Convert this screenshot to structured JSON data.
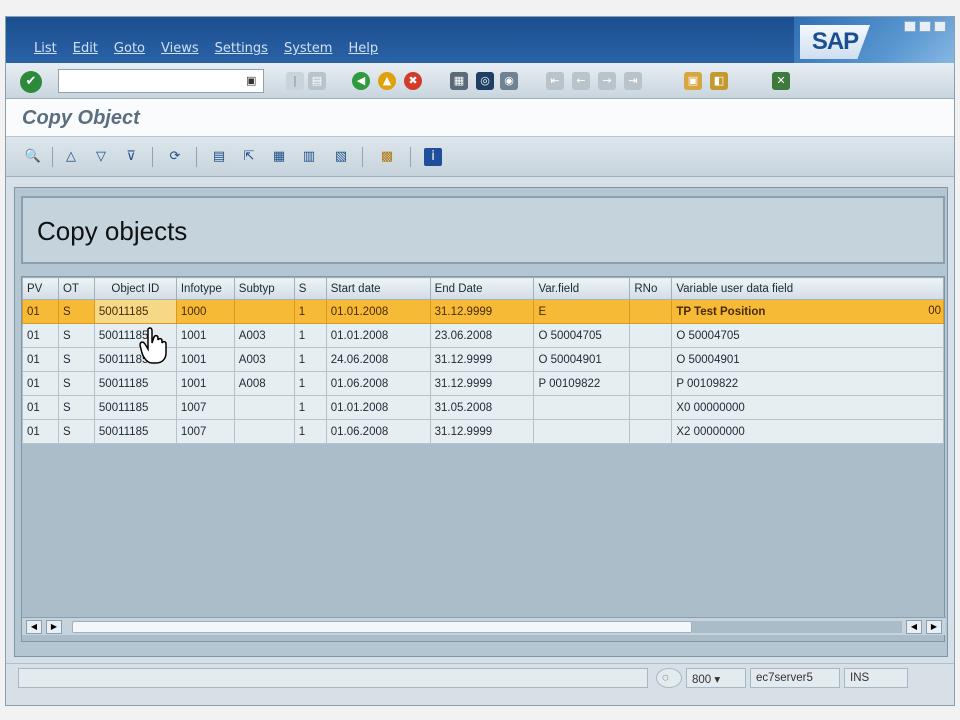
{
  "menu": [
    "List",
    "Edit",
    "Goto",
    "Views",
    "Settings",
    "System",
    "Help"
  ],
  "brand": "SAP",
  "okcode": {
    "value": ""
  },
  "title": "Copy Object",
  "group_title": "Copy objects",
  "table": {
    "columns": [
      "PV",
      "OT",
      "Object ID",
      "Infotype",
      "Subtyp",
      "S",
      "Start date",
      "End Date",
      "Var.field",
      "RNo",
      "Variable user data field"
    ],
    "rows": [
      [
        "01",
        "S",
        "50011185",
        "1000",
        "",
        "1",
        "01.01.2008",
        "31.12.9999",
        "E",
        "",
        "TP       Test Position"
      ],
      [
        "01",
        "S",
        "50011185",
        "1001",
        "A003",
        "1",
        "01.01.2008",
        "23.06.2008",
        "O 50004705",
        "",
        "O 50004705"
      ],
      [
        "01",
        "S",
        "50011185",
        "1001",
        "A003",
        "1",
        "24.06.2008",
        "31.12.9999",
        "O 50004901",
        "",
        "O 50004901"
      ],
      [
        "01",
        "S",
        "50011185",
        "1001",
        "A008",
        "1",
        "01.06.2008",
        "31.12.9999",
        "P 00109822",
        "",
        "P 00109822"
      ],
      [
        "01",
        "S",
        "50011185",
        "1007",
        "",
        "1",
        "01.01.2008",
        "31.05.2008",
        "",
        "",
        "X0  00000000"
      ],
      [
        "01",
        "S",
        "50011185",
        "1007",
        "",
        "1",
        "01.06.2008",
        "31.12.9999",
        "",
        "",
        "X2  00000000"
      ]
    ],
    "selected_row": 0,
    "trailing_text": "00"
  },
  "status": {
    "client": "800",
    "server": "ec7server5",
    "mode": "INS"
  }
}
